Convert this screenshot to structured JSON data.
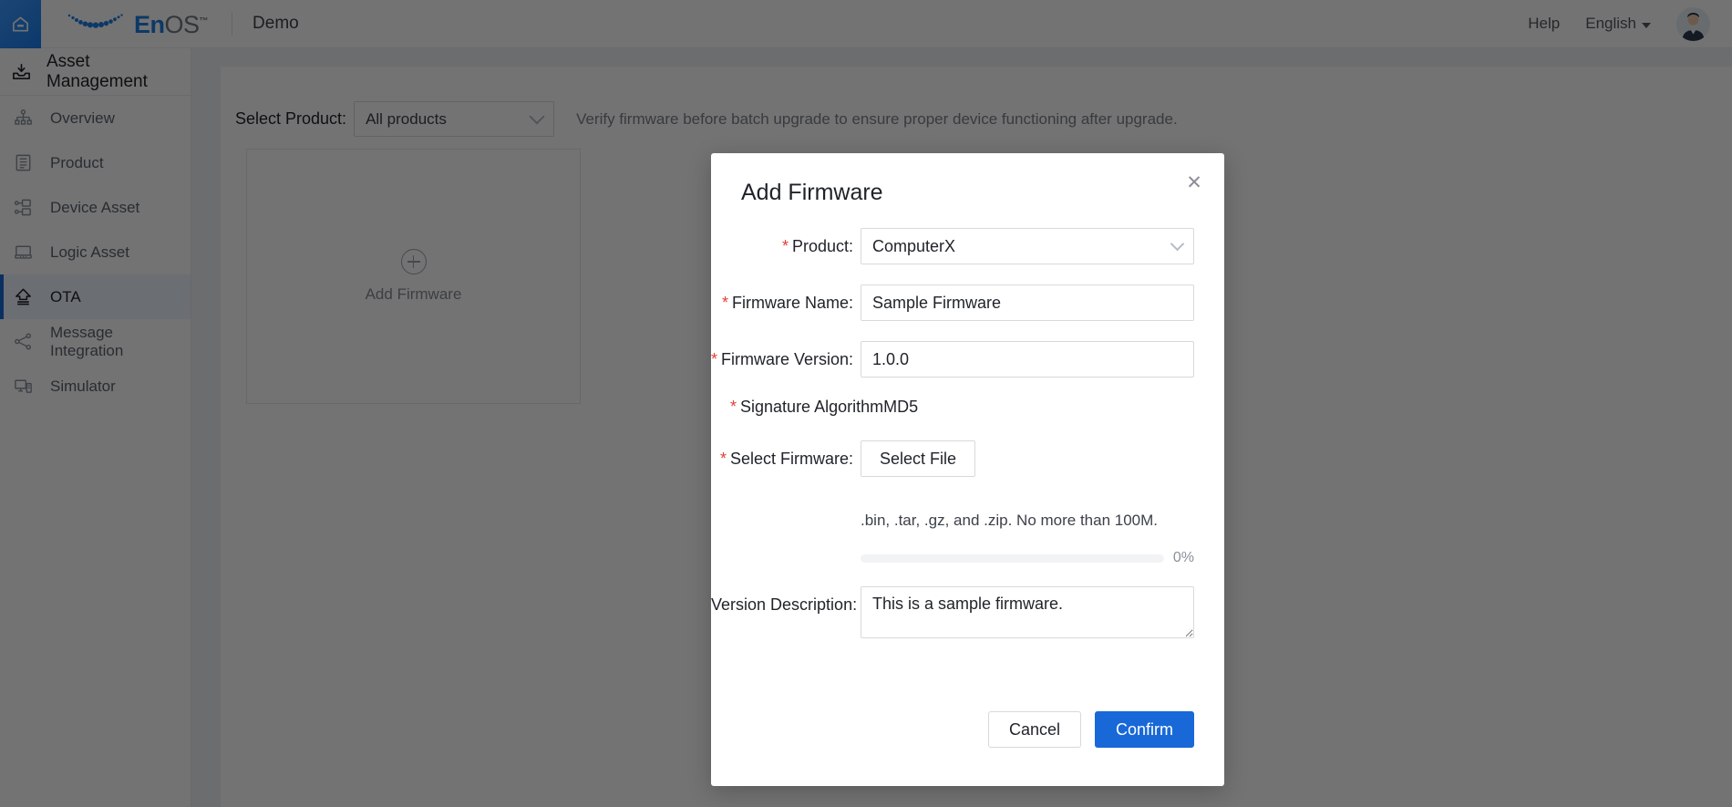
{
  "topbar": {
    "home_icon": "home-icon",
    "logo_text_primary": "En",
    "logo_text_secondary": "OS",
    "logo_trademark": "™",
    "tenant": "Demo",
    "help_label": "Help",
    "language_label": "English",
    "avatar_icon": "user-avatar"
  },
  "sidebar": {
    "header": {
      "label": "Asset Management",
      "icon": "asset-inbox-icon"
    },
    "items": [
      {
        "label": "Overview",
        "icon": "hierarchy-icon",
        "active": false
      },
      {
        "label": "Product",
        "icon": "document-stack-icon",
        "active": false
      },
      {
        "label": "Device Asset",
        "icon": "device-node-icon",
        "active": false
      },
      {
        "label": "Logic Asset",
        "icon": "server-icon",
        "active": false
      },
      {
        "label": "OTA",
        "icon": "upload-arrow-icon",
        "active": true
      },
      {
        "label": "Message Integration",
        "icon": "share-nodes-icon",
        "active": false
      },
      {
        "label": "Simulator",
        "icon": "monitor-icon",
        "active": false
      }
    ]
  },
  "main": {
    "filter_label": "Select Product:",
    "product_filter_value": "All products",
    "hint": "Verify firmware before batch upgrade to ensure proper device functioning after upgrade.",
    "add_card_label": "Add Firmware",
    "add_card_icon": "plus-circle-icon"
  },
  "modal": {
    "title": "Add Firmware",
    "close_icon": "close-icon",
    "fields": {
      "product": {
        "label": "Product:",
        "required": true,
        "value": "ComputerX",
        "chevron_icon": "chevron-down-icon"
      },
      "firmware_name": {
        "label": "Firmware Name:",
        "required": true,
        "value": "Sample Firmware",
        "placeholder": ""
      },
      "firmware_version": {
        "label": "Firmware Version:",
        "required": true,
        "value": "1.0.0",
        "placeholder": ""
      },
      "signature_algorithm": {
        "label": "Signature Algorithm",
        "required": true,
        "value": "MD5"
      },
      "select_firmware": {
        "label": "Select Firmware:",
        "required": true,
        "button_label": "Select File",
        "upload_hint": ".bin, .tar, .gz, and .zip. No more than 100M.",
        "progress_percent_label": "0%",
        "progress_percent": 0
      },
      "version_description": {
        "label": "Version Description:",
        "required": false,
        "value": "This is a sample firmware.",
        "placeholder": ""
      }
    },
    "footer": {
      "cancel_label": "Cancel",
      "confirm_label": "Confirm"
    }
  },
  "colors": {
    "accent": "#1868d8",
    "required_asterisk": "#e3403a",
    "sidebar_active_bg": "#eef4fe",
    "brand_blue": "#1b7ee5"
  }
}
